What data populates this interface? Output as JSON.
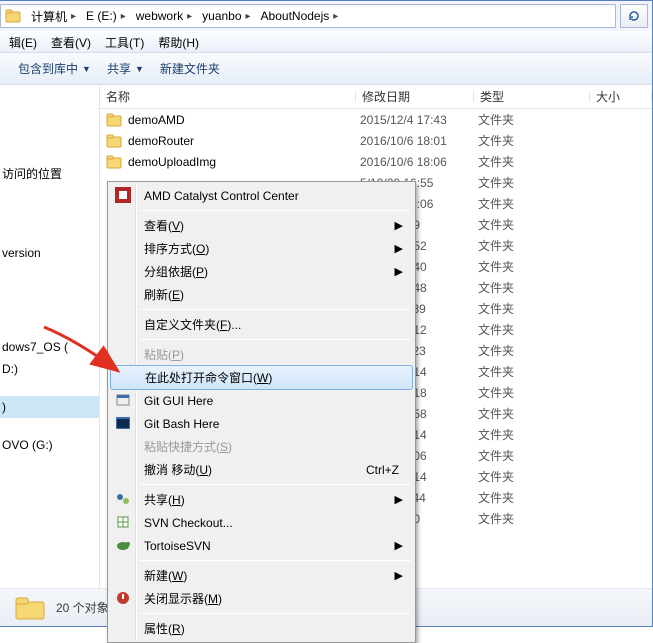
{
  "breadcrumb": {
    "items": [
      "计算机",
      "E (E:)",
      "webwork",
      "yuanbo",
      "AboutNodejs"
    ]
  },
  "menubar": {
    "items": [
      "辑(E)",
      "查看(V)",
      "工具(T)",
      "帮助(H)"
    ]
  },
  "toolbar": {
    "include": "包含到库中",
    "share": "共享",
    "newfolder": "新建文件夹"
  },
  "sidebar": {
    "items": [
      "",
      "",
      "",
      "",
      "访问的位置",
      "",
      "",
      "",
      "version",
      "",
      "",
      "",
      "",
      "dows7_OS (",
      "D:)",
      "",
      ")",
      "",
      "OVO (G:)"
    ]
  },
  "columns": {
    "name": "名称",
    "date": "修改日期",
    "type": "类型",
    "size": "大小"
  },
  "rows": [
    {
      "name": "demoAMD",
      "date": "2015/12/4 17:43",
      "type": "文件夹"
    },
    {
      "name": "demoRouter",
      "date": "2016/10/6 18:01",
      "type": "文件夹"
    },
    {
      "name": "demoUploadImg",
      "date": "2016/10/6 18:06",
      "type": "文件夹"
    },
    {
      "name": "",
      "date": "5/10/20 16:55",
      "type": "文件夹"
    },
    {
      "name": "",
      "date": "5/12/28 18:06",
      "type": "文件夹"
    },
    {
      "name": "",
      "date": "5/7/8 18:09",
      "type": "文件夹"
    },
    {
      "name": "",
      "date": "5/10/5 14:52",
      "type": "文件夹"
    },
    {
      "name": "",
      "date": "5/5/25 17:40",
      "type": "文件夹"
    },
    {
      "name": "",
      "date": "5/10/5 16:48",
      "type": "文件夹"
    },
    {
      "name": "",
      "date": "5/5/25 11:39",
      "type": "文件夹"
    },
    {
      "name": "",
      "date": "5/7/26 15:12",
      "type": "文件夹"
    },
    {
      "name": "",
      "date": "5/9/26 11:23",
      "type": "文件夹"
    },
    {
      "name": "",
      "date": "5/8/29 14:14",
      "type": "文件夹"
    },
    {
      "name": "",
      "date": "5/9/26 14:18",
      "type": "文件夹"
    },
    {
      "name": "",
      "date": "5/9/26 17:58",
      "type": "文件夹"
    },
    {
      "name": "",
      "date": "5/9/26 12:14",
      "type": "文件夹"
    },
    {
      "name": "",
      "date": "5/9/22 10:06",
      "type": "文件夹"
    },
    {
      "name": "",
      "date": "5/9/26 13:14",
      "type": "文件夹"
    },
    {
      "name": "",
      "date": "5/7/21 11:44",
      "type": "文件夹"
    },
    {
      "name": "",
      "date": "5/0/1 15:50",
      "type": "文件夹"
    }
  ],
  "status": {
    "text": "20 个对象"
  },
  "ctx": {
    "amd": "AMD Catalyst Control Center",
    "view": "查看",
    "view_k": "V",
    "sort": "排序方式",
    "sort_k": "O",
    "group": "分组依据",
    "group_k": "P",
    "refresh": "刷新",
    "refresh_k": "E",
    "custom": "自定义文件夹",
    "custom_k": "F",
    "custom_suffix": "...",
    "paste": "粘贴",
    "paste_k": "P",
    "opencmd": "在此处打开命令窗口",
    "opencmd_k": "W",
    "gitgui": "Git GUI Here",
    "gitbash": "Git Bash Here",
    "pasteshortcut": "粘贴快捷方式",
    "pasteshortcut_k": "S",
    "undo": "撤消 移动",
    "undo_k": "U",
    "undo_kbd": "Ctrl+Z",
    "share": "共享",
    "share_k": "H",
    "svnco": "SVN Checkout...",
    "tortoise": "TortoiseSVN",
    "new": "新建",
    "new_k": "W",
    "closedisp": "关闭显示器",
    "closedisp_k": "M",
    "props": "属性",
    "props_k": "R"
  }
}
